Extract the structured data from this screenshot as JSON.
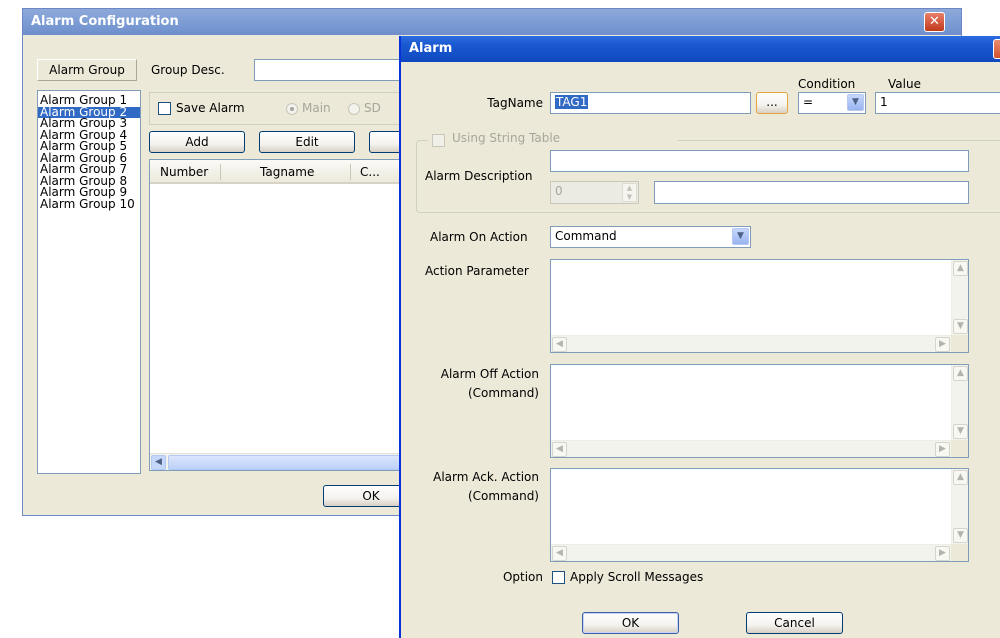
{
  "config_window": {
    "title": "Alarm Configuration",
    "alarm_group_label": "Alarm Group",
    "group_desc_label": "Group Desc.",
    "group_desc_value": "",
    "groups": [
      "Alarm Group 1",
      "Alarm Group 2",
      "Alarm Group 3",
      "Alarm Group 4",
      "Alarm Group 5",
      "Alarm Group 6",
      "Alarm Group 7",
      "Alarm Group 8",
      "Alarm Group 9",
      "Alarm Group 10"
    ],
    "selected_group": 1,
    "save_alarm_label": "Save Alarm",
    "main_label": "Main",
    "sd_label": "SD",
    "add_label": "Add",
    "edit_label": "Edit",
    "col_number": "Number",
    "col_tagname": "Tagname",
    "col_c": "C...",
    "ok_label": "OK"
  },
  "alarm_dialog": {
    "title": "Alarm",
    "condition_label": "Condition",
    "value_label": "Value",
    "tagname_label": "TagName",
    "tagname_value": "TAG1",
    "browse_label": "...",
    "condition_value": "=",
    "value_value": "1",
    "using_string_table_label": "Using String Table",
    "alarm_description_label": "Alarm Description",
    "alarm_description_value": "",
    "spin_value": "0",
    "string_value": "",
    "alarm_on_action_label": "Alarm On Action",
    "alarm_on_action_value": "Command",
    "action_parameter_label": "Action Parameter",
    "alarm_off_action_label_1": "Alarm Off Action",
    "alarm_off_action_label_2": "(Command)",
    "alarm_ack_action_label_1": "Alarm Ack. Action",
    "alarm_ack_action_label_2": "(Command)",
    "option_label": "Option",
    "apply_scroll_label": "Apply Scroll Messages",
    "ok_label": "OK",
    "cancel_label": "Cancel"
  },
  "colors": {
    "selection": "#316ac5",
    "title_active": "#1a58d1",
    "title_inactive": "#7f9fd6",
    "dialog_bg": "#ece9d8"
  },
  "icons": {
    "close": "close-icon",
    "dropdown": "chevron-down-icon",
    "scroll_up": "scroll-up-icon",
    "scroll_down": "scroll-down-icon",
    "scroll_left": "scroll-left-icon",
    "scroll_right": "scroll-right-icon"
  }
}
